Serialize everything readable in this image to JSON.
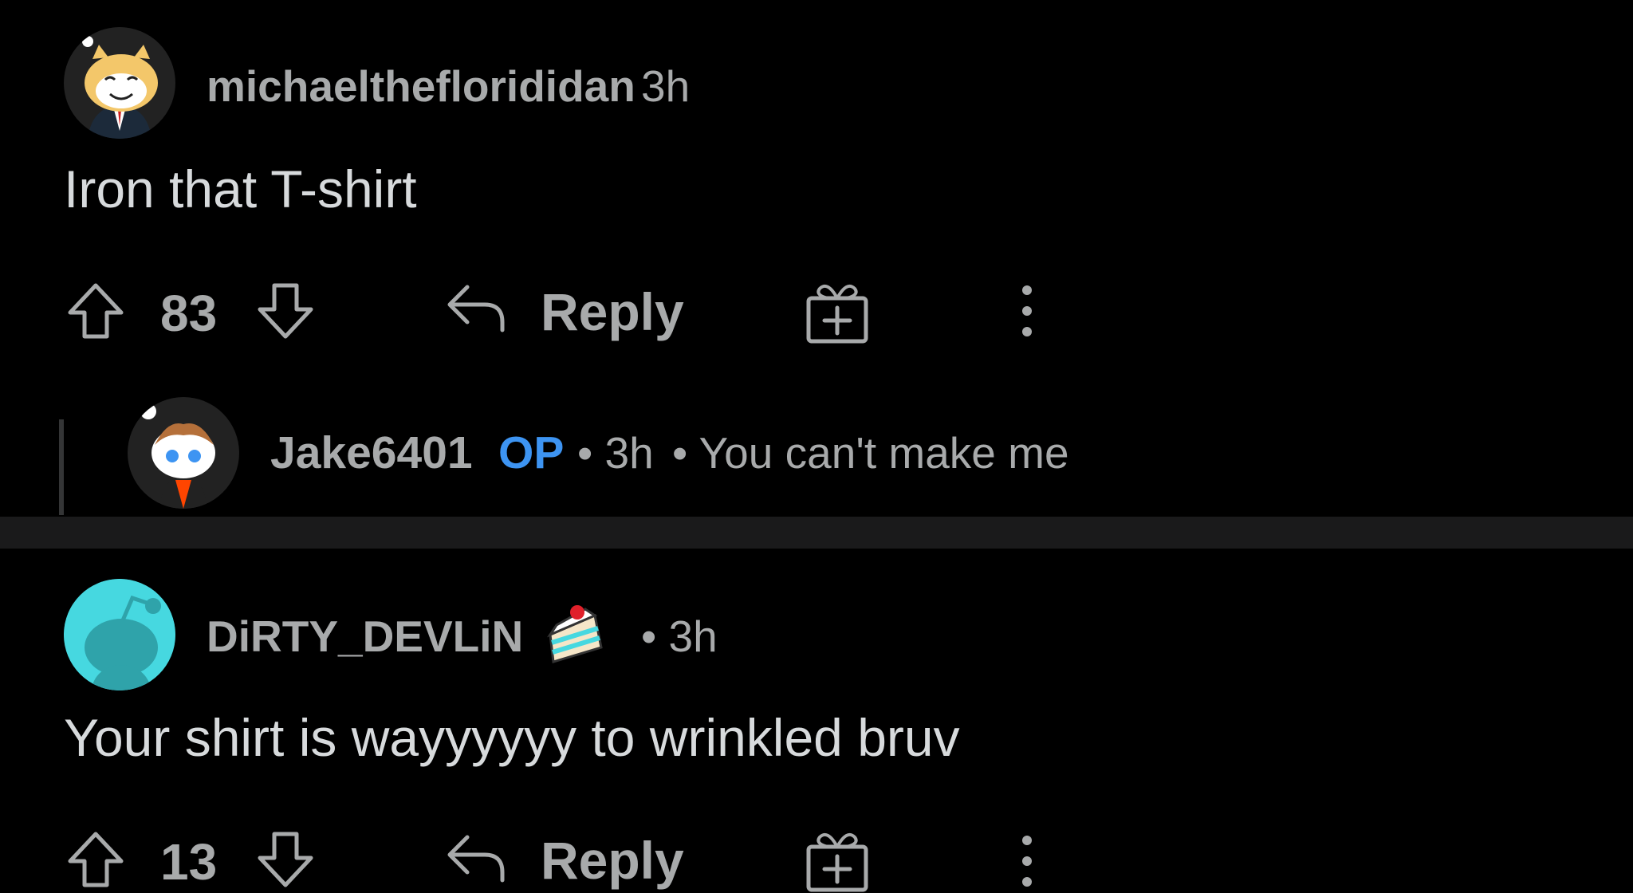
{
  "comments": [
    {
      "username": "michaeltheflorididan",
      "time": "3h",
      "body": "Iron that T-shirt",
      "score": "83",
      "reply_label": "Reply"
    },
    {
      "username": "DiRTY_DEVLiN",
      "time": "• 3h",
      "body": "Your shirt is wayyyyyy to wrinkled bruv",
      "score": "13",
      "reply_label": "Reply"
    }
  ],
  "collapsed_reply": {
    "username": "Jake6401",
    "op_badge": "OP",
    "time": "• 3h",
    "preview": "• You can't make me"
  },
  "icons": {
    "upvote": "arrow-up-icon",
    "downvote": "arrow-down-icon",
    "reply": "reply-arrow-icon",
    "award": "gift-icon",
    "more": "more-vertical-icon",
    "cake": "cake-day-icon"
  },
  "colors": {
    "background": "#000000",
    "text": "#d7dadc",
    "muted": "#a8aaab",
    "op": "#3d94f2",
    "avatar_teal": "#46d8e0"
  }
}
